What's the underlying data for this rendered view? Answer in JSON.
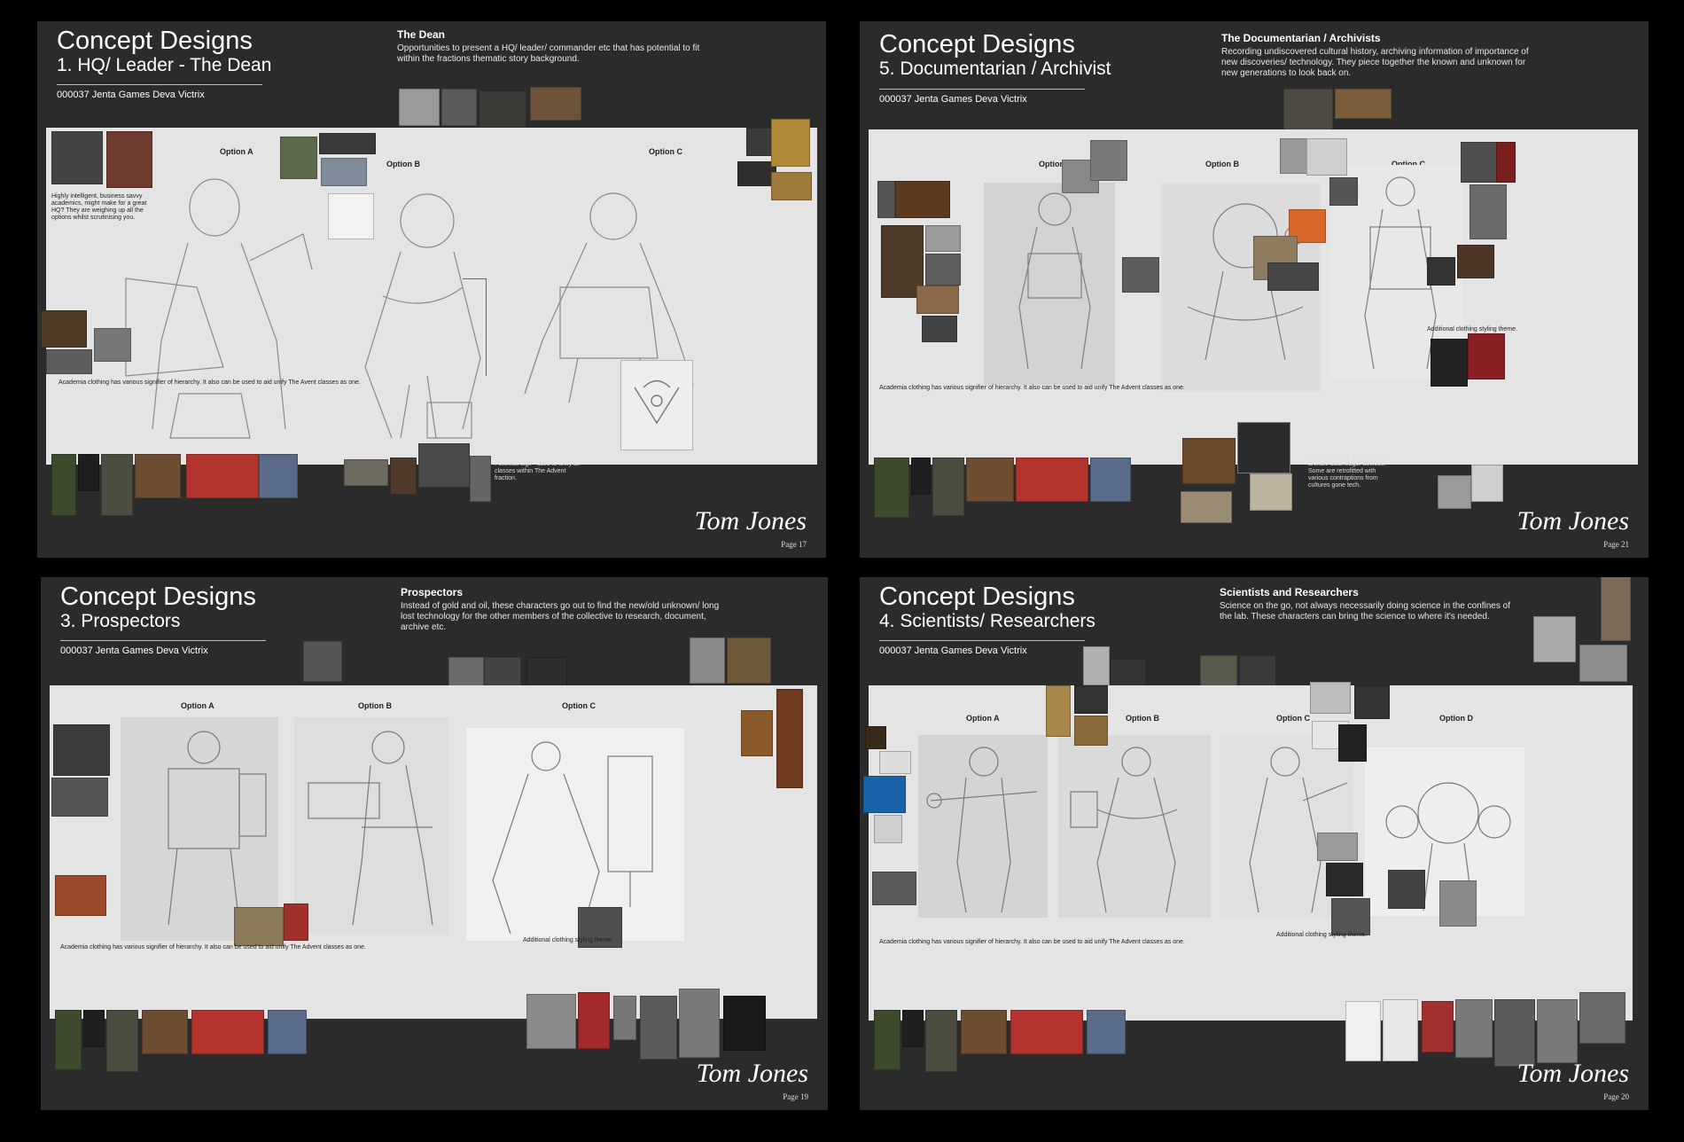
{
  "pages": [
    {
      "heading": "Concept Designs",
      "subheading": "1. HQ/ Leader - The Dean",
      "ref": "000037 Jenta Games Deva Victrix",
      "section_title": "The Dean",
      "section_text": "Opportunities to present a HQ/ leader/ commander etc that has potential to fit within the fractions thematic story background.",
      "options": [
        "Option A",
        "Option B",
        "Option C"
      ],
      "note_left": "Highly intelligent, business savvy academics, might make for a great HQ? They are weighing up all the options whilst scrutinising you.",
      "caption": "Academia clothing has various signifier of hierarchy. It also can be used to aid unify The Avent classes as one.",
      "note_right": "Potential sigil - used to unify all classes within The Advent fraction.",
      "signature": "Tom Jones",
      "page": "Page 17"
    },
    {
      "heading": "Concept Designs",
      "subheading": "5. Documentarian / Archivist",
      "ref": "000037 Jenta Games Deva Victrix",
      "section_title": "The Documentarian / Archivists",
      "section_text": "Recording undiscovered cultural history, archiving information of importance of new discoveries/ technology. They piece together the known and unknown for new generations to look back on.",
      "options": [
        "Option A",
        "Option B",
        "Option C"
      ],
      "caption": "Academia clothing has various signifier of hierarchy. It also can be used to aid unify The Advent classes as one.",
      "note_right": "Additional clothing styling theme.",
      "note_bottom": "Documentarian and archivers archaic data ledger devices. Some are retrofitted with various contraptions from cultures gone tech.",
      "signature": "Tom Jones",
      "page": "Page 21"
    },
    {
      "heading": "Concept Designs",
      "subheading": "3. Prospectors",
      "ref": "000037 Jenta Games Deva Victrix",
      "section_title": "Prospectors",
      "section_text": "Instead of gold and oil, these characters go out to find the new/old unknown/ long lost technology for the other members of the collective to research, document, archive etc.",
      "options": [
        "Option A",
        "Option B",
        "Option C"
      ],
      "caption": "Academia clothing has various signifier of hierarchy. It also can be used to aid unify The Advent classes as one.",
      "note_right": "Additional clothing styling theme.",
      "signature": "Tom Jones",
      "page": "Page 19"
    },
    {
      "heading": "Concept Designs",
      "subheading": "4. Scientists/ Researchers",
      "ref": "000037 Jenta Games Deva Victrix",
      "section_title": "Scientists and Researchers",
      "section_text": "Science on the go, not always necessarily doing science in the confines of the lab. These characters can bring the science to where it's needed.",
      "options": [
        "Option A",
        "Option B",
        "Option C",
        "Option D"
      ],
      "caption": "Academia clothing has various signifier of hierarchy. It also can be used to aid unify The Advent classes as one.",
      "note_right": "Additional clothing styling theme.",
      "signature": "Tom Jones",
      "page": "Page 20"
    }
  ],
  "colors": {
    "sheet": "#2b2b2b",
    "board": "#e4e4e4",
    "text": "#ffffff"
  }
}
